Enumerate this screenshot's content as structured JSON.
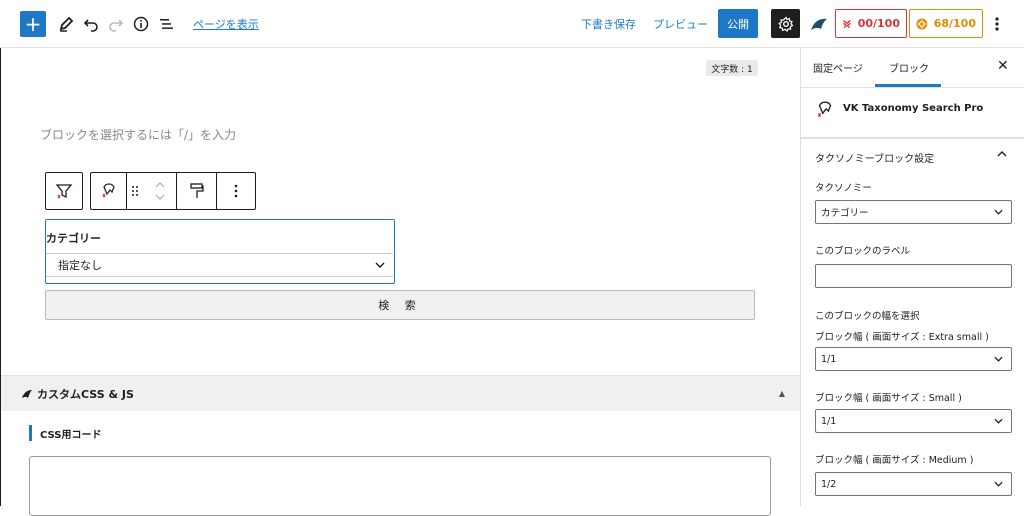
{
  "header": {
    "add_block": "+",
    "view_page_link": "ページを表示",
    "save_draft": "下書き保存",
    "preview": "プレビュー",
    "publish": "公開",
    "score_red": "00/100",
    "score_orange": "68/100"
  },
  "editor": {
    "word_count": "文字数 : 1",
    "placeholder": "ブロックを選択するには「/」を入力",
    "taxonomy_label": "カテゴリー",
    "taxonomy_select_value": "指定なし",
    "search_button": "検 索",
    "custom_panel_title": "カスタムCSS & JS",
    "css_code_label": "CSS用コード"
  },
  "sidebar": {
    "tab_post": "固定ページ",
    "tab_block": "ブロック",
    "block_title": "VK Taxonomy Search Pro",
    "section_title": "タクソノミーブロック設定",
    "taxonomy_label": "タクソノミー",
    "taxonomy_value": "カテゴリー",
    "block_label_label": "このブロックのラベル",
    "width_section_label": "このブロックの幅を選択",
    "width_xs_label": "ブロック幅 ( 画面サイズ : Extra small )",
    "width_xs_value": "1/1",
    "width_sm_label": "ブロック幅 ( 画面サイズ : Small )",
    "width_sm_value": "1/1",
    "width_md_label": "ブロック幅 ( 画面サイズ : Medium )",
    "width_md_value": "1/2"
  },
  "colors": {
    "accent": "#1e78c8",
    "score_red": "#d63638",
    "score_orange": "#e68a00"
  }
}
